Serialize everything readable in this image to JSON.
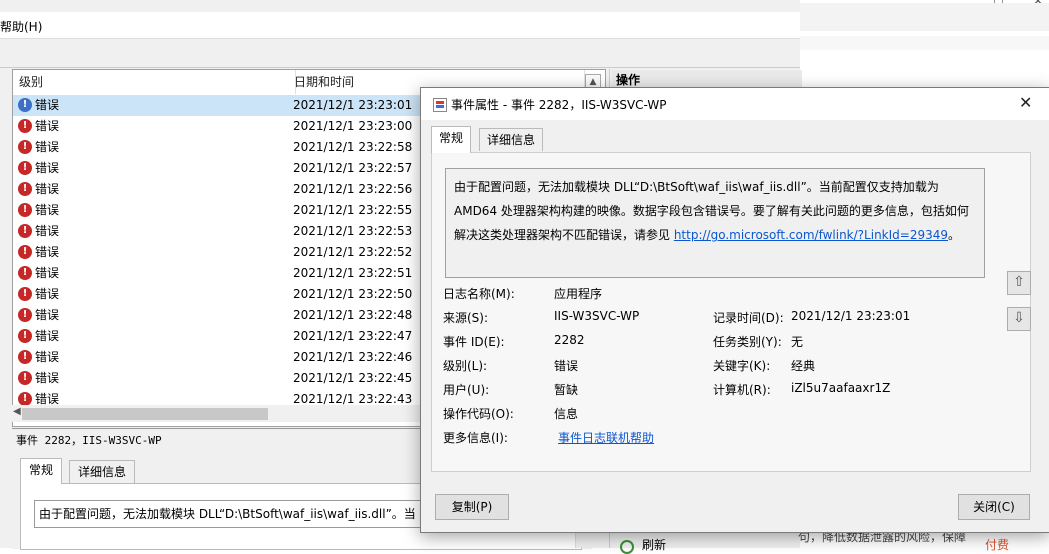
{
  "background_window": {
    "menu_help": "帮助(H)",
    "columns": {
      "level": "级别",
      "datetime": "日期和时间"
    },
    "events": [
      {
        "level": "错误",
        "datetime": "2021/12/1 23:23:01"
      },
      {
        "level": "错误",
        "datetime": "2021/12/1 23:23:00"
      },
      {
        "level": "错误",
        "datetime": "2021/12/1 23:22:58"
      },
      {
        "level": "错误",
        "datetime": "2021/12/1 23:22:57"
      },
      {
        "level": "错误",
        "datetime": "2021/12/1 23:22:56"
      },
      {
        "level": "错误",
        "datetime": "2021/12/1 23:22:55"
      },
      {
        "level": "错误",
        "datetime": "2021/12/1 23:22:53"
      },
      {
        "level": "错误",
        "datetime": "2021/12/1 23:22:52"
      },
      {
        "level": "错误",
        "datetime": "2021/12/1 23:22:51"
      },
      {
        "level": "错误",
        "datetime": "2021/12/1 23:22:50"
      },
      {
        "level": "错误",
        "datetime": "2021/12/1 23:22:48"
      },
      {
        "level": "错误",
        "datetime": "2021/12/1 23:22:47"
      },
      {
        "level": "错误",
        "datetime": "2021/12/1 23:22:46"
      },
      {
        "level": "错误",
        "datetime": "2021/12/1 23:22:45"
      },
      {
        "level": "错误",
        "datetime": "2021/12/1 23:22:43"
      }
    ],
    "detail_title": "事件 2282，IIS-W3SVC-WP",
    "detail_tabs": {
      "general": "常规",
      "details": "详细信息"
    },
    "detail_text": "由于配置问题，无法加载模块 DLL“D:\\BtSoft\\waf_iis\\waf_iis.dll”。当",
    "actions_header": "操作",
    "refresh_label": "刷新",
    "far_right_text": "句，降低数据泄露的风险，保障",
    "far_right_pay": "付费"
  },
  "dialog": {
    "title": "事件属性 - 事件 2282，IIS-W3SVC-WP",
    "tabs": {
      "general": "常规",
      "details": "详细信息"
    },
    "description_text": "由于配置问题，无法加载模块 DLL“D:\\BtSoft\\waf_iis\\waf_iis.dll”。当前配置仅支持加载为 AMD64 处理器架构构建的映像。数据字段包含错误号。要了解有关此问题的更多信息，包括如何解决这类处理器架构不匹配错误，请参见 ",
    "description_link": "http://go.microsoft.com/fwlink/?LinkId=29349",
    "description_end": "。",
    "fields": {
      "log_name_label": "日志名称(M):",
      "log_name_value": "应用程序",
      "source_label": "来源(S):",
      "source_value": "IIS-W3SVC-WP",
      "event_id_label": "事件 ID(E):",
      "event_id_value": "2282",
      "level_label": "级别(L):",
      "level_value": "错误",
      "user_label": "用户(U):",
      "user_value": "暂缺",
      "opcode_label": "操作代码(O):",
      "opcode_value": "信息",
      "more_info_label": "更多信息(I):",
      "more_info_value": "事件日志联机帮助",
      "logged_label": "记录时间(D):",
      "logged_value": "2021/12/1 23:23:01",
      "task_label": "任务类别(Y):",
      "task_value": "无",
      "keywords_label": "关键字(K):",
      "keywords_value": "经典",
      "computer_label": "计算机(R):",
      "computer_value": "iZl5u7aafaaxr1Z"
    },
    "copy_button": "复制(P)",
    "close_button": "关闭(C)"
  }
}
